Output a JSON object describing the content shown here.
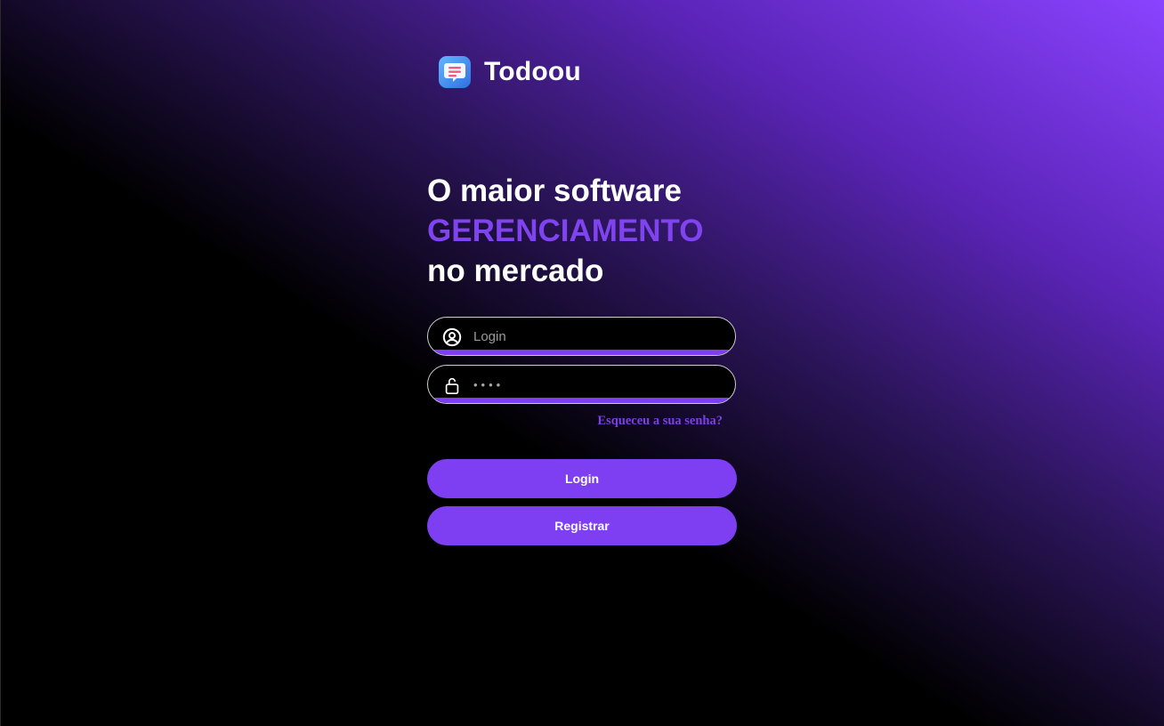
{
  "brand": {
    "name": "Todoou",
    "icon": "todo-list-app-icon"
  },
  "hero": {
    "line1": "O maior software",
    "line2": "GERENCIAMENTO",
    "line3": "no mercado"
  },
  "form": {
    "login": {
      "placeholder": "Login",
      "value": "",
      "icon": "user-circle-icon"
    },
    "password": {
      "placeholder": "",
      "value": "••••",
      "icon": "unlock-icon"
    },
    "forgot_label": "Esqueceu a sua senha?",
    "login_button": "Login",
    "register_button": "Registrar"
  },
  "colors": {
    "accent": "#7e3ff2",
    "background": "#000000",
    "gradient_top_right": "#8a43ff"
  }
}
